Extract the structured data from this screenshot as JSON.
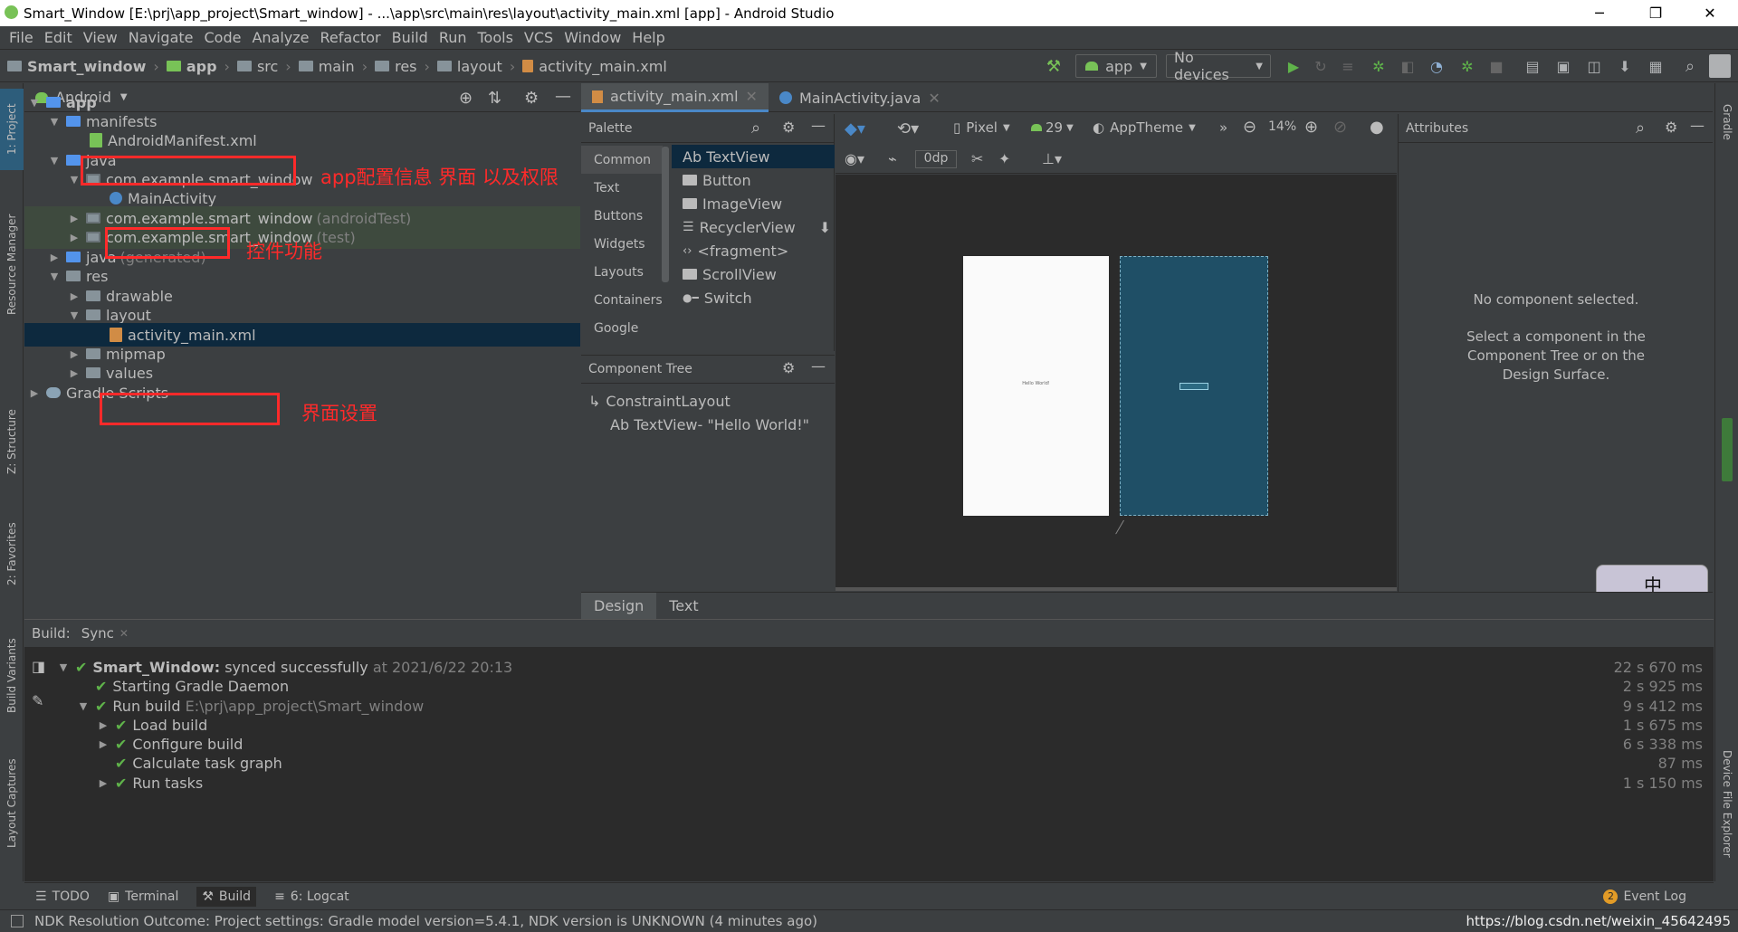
{
  "window": {
    "title": "Smart_Window [E:\\prj\\app_project\\Smart_window] - ...\\app\\src\\main\\res\\layout\\activity_main.xml [app] - Android Studio",
    "minimize": "─",
    "restore": "❐",
    "close": "✕"
  },
  "menu": [
    "File",
    "Edit",
    "View",
    "Navigate",
    "Code",
    "Analyze",
    "Refactor",
    "Build",
    "Run",
    "Tools",
    "VCS",
    "Window",
    "Help"
  ],
  "breadcrumb": [
    "Smart_window",
    "app",
    "src",
    "main",
    "res",
    "layout",
    "activity_main.xml"
  ],
  "toolbar": {
    "run_config": "app",
    "device": "No devices"
  },
  "left_tabs": [
    "1: Project",
    "Resource Manager",
    "Z: Structure",
    "2: Favorites",
    "Build Variants",
    "Layout Captures"
  ],
  "right_tabs": [
    "Gradle",
    "Device File Explorer"
  ],
  "project": {
    "view_selector": "Android",
    "tree": [
      {
        "label": "app",
        "extra": ""
      },
      {
        "label": "manifests",
        "extra": ""
      },
      {
        "label": "AndroidManifest.xml",
        "extra": ""
      },
      {
        "label": "java",
        "extra": ""
      },
      {
        "label": "com.example.smart_window",
        "extra": ""
      },
      {
        "label": "MainActivity",
        "extra": ""
      },
      {
        "label": "com.example.smart_window",
        "extra": "(androidTest)"
      },
      {
        "label": "com.example.smart_window",
        "extra": "(test)"
      },
      {
        "label": "java",
        "extra": "(generated)"
      },
      {
        "label": "res",
        "extra": ""
      },
      {
        "label": "drawable",
        "extra": ""
      },
      {
        "label": "layout",
        "extra": ""
      },
      {
        "label": "activity_main.xml",
        "extra": ""
      },
      {
        "label": "mipmap",
        "extra": ""
      },
      {
        "label": "values",
        "extra": ""
      },
      {
        "label": "Gradle Scripts",
        "extra": ""
      }
    ]
  },
  "annotations": {
    "manifest": "app配置信息 界面 以及权限",
    "mainactivity": "控件功能",
    "layout": "界面设置"
  },
  "editor_tabs": [
    "activity_main.xml",
    "MainActivity.java"
  ],
  "palette": {
    "title": "Palette",
    "categories": [
      "Common",
      "Text",
      "Buttons",
      "Widgets",
      "Layouts",
      "Containers",
      "Google"
    ],
    "items": [
      "Ab TextView",
      "Button",
      "ImageView",
      "RecyclerView",
      "<fragment>",
      "ScrollView",
      "Switch"
    ]
  },
  "component_tree": {
    "title": "Component Tree",
    "root": "ConstraintLayout",
    "child": "Ab TextView- \"Hello World!\""
  },
  "design_toolbar": {
    "device": "Pixel",
    "api": "29",
    "theme": "AppTheme",
    "zoom": "14%",
    "margin": "0dp"
  },
  "preview": {
    "text": "Hello World!"
  },
  "attributes": {
    "title": "Attributes",
    "empty": "No component selected.",
    "hint": "Select a component in the Component Tree or on the Design Surface."
  },
  "design_tabs": [
    "Design",
    "Text"
  ],
  "build": {
    "label": "Build:",
    "tab": "Sync",
    "rows": [
      {
        "label": "Smart_Window:",
        "suffix": "synced successfully",
        "meta": "at 2021/6/22 20:13",
        "time": "22 s 670 ms"
      },
      {
        "label": "Starting Gradle Daemon",
        "suffix": "",
        "meta": "",
        "time": "2 s 925 ms"
      },
      {
        "label": "Run build",
        "suffix": "",
        "meta": "E:\\prj\\app_project\\Smart_window",
        "time": "9 s 412 ms"
      },
      {
        "label": "Load build",
        "suffix": "",
        "meta": "",
        "time": "1 s 675 ms"
      },
      {
        "label": "Configure build",
        "suffix": "",
        "meta": "",
        "time": "6 s 338 ms"
      },
      {
        "label": "Calculate task graph",
        "suffix": "",
        "meta": "",
        "time": "87 ms"
      },
      {
        "label": "Run tasks",
        "suffix": "",
        "meta": "",
        "time": "1 s 150 ms"
      }
    ]
  },
  "bottom_tabs": [
    "TODO",
    "Terminal",
    "Build",
    "6: Logcat"
  ],
  "event_log": {
    "count": "2",
    "label": "Event Log"
  },
  "status": {
    "message": "NDK Resolution Outcome: Project settings: Gradle model version=5.4.1, NDK version is UNKNOWN (4 minutes ago)",
    "watermark": "https://blog.csdn.net/weixin_45642495"
  },
  "ime": {
    "char": "中"
  },
  "colors": {
    "accent": "#4a88c7",
    "annotation": "#ff2a2a",
    "blueprint": "#1f4f66",
    "success": "#5fb34a"
  }
}
